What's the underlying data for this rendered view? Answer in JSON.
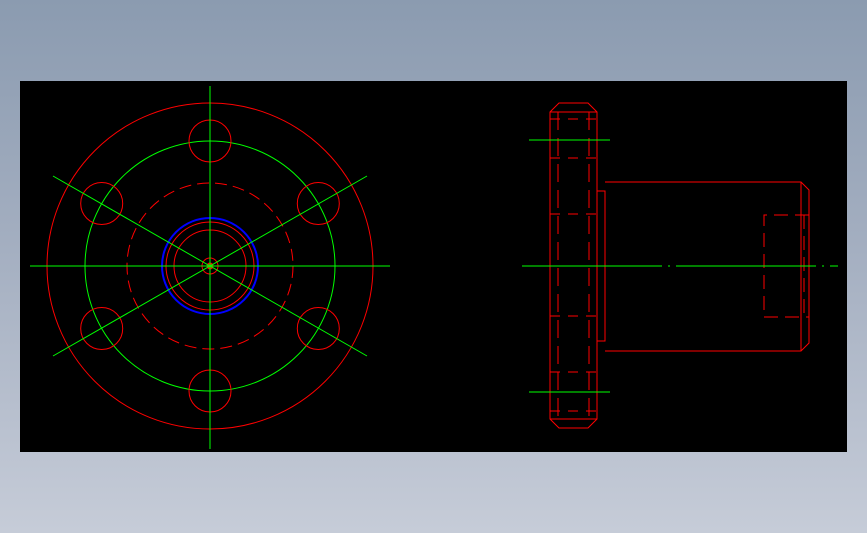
{
  "colors": {
    "background_gradient_top": "#8b9bb0",
    "background_gradient_bottom": "#c6ccd8",
    "canvas": "#000000",
    "outline": "#ff0000",
    "center_line": "#00ff00",
    "bore_circle": "#0000ff"
  },
  "drawing": {
    "front_view": {
      "bolt_hole_count": 6
    },
    "side_view": {
      "hidden_lines": "dashed"
    }
  }
}
